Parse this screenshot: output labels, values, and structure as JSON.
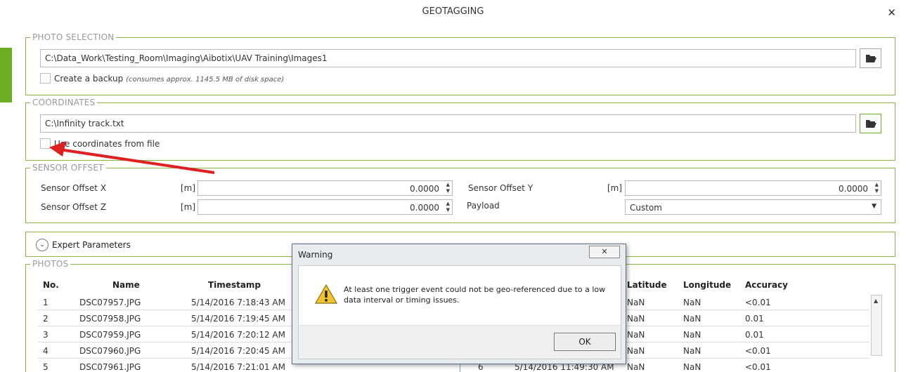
{
  "window": {
    "title": "GEOTAGGING",
    "close_icon": "✕"
  },
  "photo_selection": {
    "legend": "PHOTO SELECTION",
    "path": "C:\\Data_Work\\Testing_Room\\Imaging\\Aibotix\\UAV Training\\Images1",
    "backup_label": "Create a backup",
    "backup_note": "(consumes approx. 1145.5 MB of disk space)",
    "backup_checked": false
  },
  "coordinates": {
    "legend": "COORDINATES",
    "path": "C:\\Infinity track.txt",
    "use_file_label": "Use coordinates from file",
    "use_file_checked": false
  },
  "sensor_offset": {
    "legend": "SENSOR OFFSET",
    "x_label": "Sensor Offset X",
    "x_unit": "[m]",
    "x_value": "0.0000",
    "y_label": "Sensor Offset Y",
    "y_unit": "[m]",
    "y_value": "0.0000",
    "z_label": "Sensor Offset Z",
    "z_unit": "[m]",
    "z_value": "0.0000",
    "payload_label": "Payload",
    "payload_value": "Custom"
  },
  "expert": {
    "label": "Expert Parameters"
  },
  "photos": {
    "legend": "PHOTOS",
    "headers": [
      "No.",
      "Name",
      "Timestamp",
      "Latitude",
      "Longitude",
      "Accuracy"
    ],
    "rows": [
      {
        "no": "1",
        "name": "DSC07957.JPG",
        "timestamp": "5/14/2016 7:18:43 AM",
        "lat": "NaN",
        "lon": "NaN",
        "acc": "<0.01"
      },
      {
        "no": "2",
        "name": "DSC07958.JPG",
        "timestamp": "5/14/2016 7:19:45 AM",
        "lat": "NaN",
        "lon": "NaN",
        "acc": "0.01"
      },
      {
        "no": "3",
        "name": "DSC07959.JPG",
        "timestamp": "5/14/2016 7:20:12 AM",
        "lat": "NaN",
        "lon": "NaN",
        "acc": "0.01"
      },
      {
        "no": "4",
        "name": "DSC07960.JPG",
        "timestamp": "5/14/2016 7:20:45 AM",
        "lat": "NaN",
        "lon": "NaN",
        "acc": "<0.01"
      },
      {
        "no": "5",
        "name": "DSC07961.JPG",
        "timestamp": "5/14/2016 7:21:01 AM",
        "lat": "NaN",
        "lon": "NaN",
        "acc": "<0.01"
      }
    ],
    "partial_row": {
      "no": "6",
      "timestamp": "5/14/2016 11:49:30 AM"
    }
  },
  "dialog": {
    "title": "Warning",
    "close_icon": "✕",
    "message": "At least one trigger event could not be geo-referenced due to a low data interval or timing issues.",
    "ok_label": "OK"
  },
  "colors": {
    "accent": "#6aaf22",
    "border": "#8ab448",
    "arrow": "#e02020"
  }
}
